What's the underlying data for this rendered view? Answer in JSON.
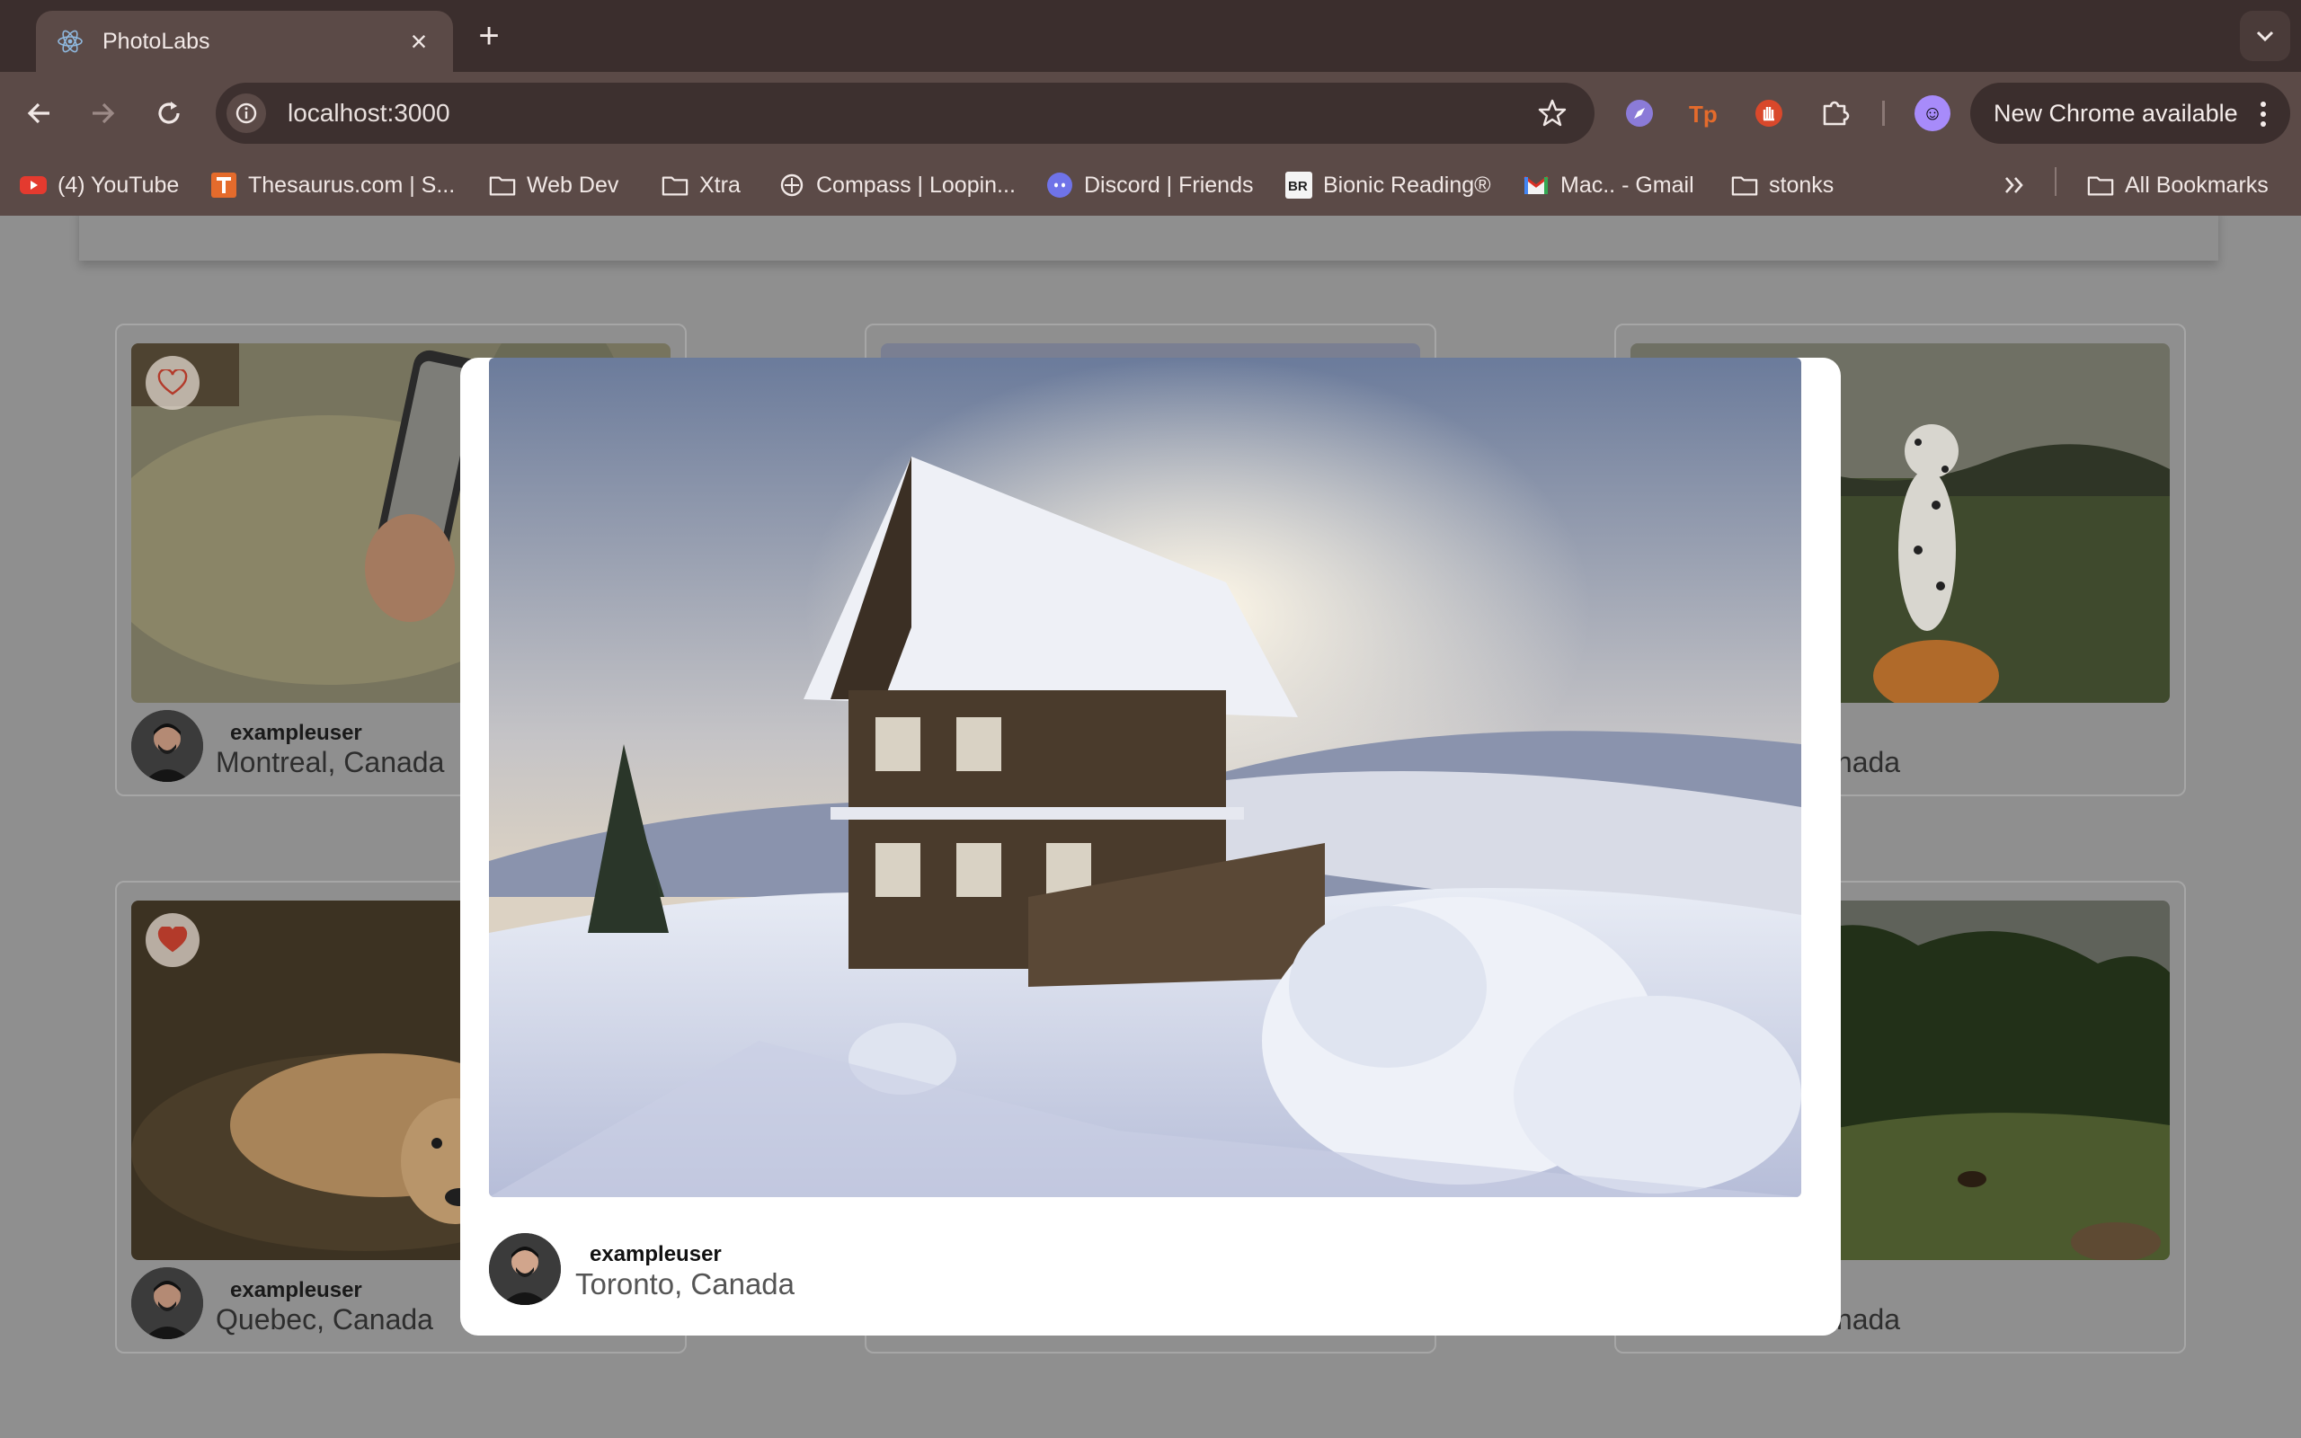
{
  "browser": {
    "tab_title": "PhotoLabs",
    "address": "localhost:3000",
    "update_label": "New Chrome available",
    "bookmarks": [
      {
        "label": "(4) YouTube",
        "icon": "youtube-icon"
      },
      {
        "label": "Thesaurus.com | S...",
        "icon": "thesaurus-icon"
      },
      {
        "label": "Web Dev",
        "icon": "folder-icon"
      },
      {
        "label": "Xtra",
        "icon": "folder-icon"
      },
      {
        "label": "Compass | Loopin...",
        "icon": "compass-icon"
      },
      {
        "label": "Discord | Friends",
        "icon": "discord-icon"
      },
      {
        "label": "Bionic Reading®",
        "icon": "bionic-reading-icon"
      },
      {
        "label": "Mac.. - Gmail",
        "icon": "gmail-icon"
      },
      {
        "label": "stonks",
        "icon": "folder-icon"
      }
    ],
    "all_bookmarks_label": "All Bookmarks",
    "colors": {
      "tabstrip": "#3b2e2d",
      "toolbar": "#5b4a47",
      "omnibox": "#3d302f"
    }
  },
  "photo_grid": {
    "cards": [
      {
        "username": "exampleuser",
        "location": "Montreal, Canada",
        "favourited": false,
        "image": "hand holding phone"
      },
      {
        "username": "",
        "location": "",
        "favourited": false,
        "image": "hidden behind modal"
      },
      {
        "username": "exampleuser",
        "location": "Canada",
        "favourited": false,
        "image": "dalmatian on pumpkin"
      },
      {
        "username": "exampleuser",
        "location": "Quebec, Canada",
        "favourited": true,
        "image": "dog lying down"
      },
      {
        "username": "",
        "location": "",
        "favourited": false,
        "image": "hidden behind modal"
      },
      {
        "username": "exampleuser",
        "location": "Canada",
        "favourited": false,
        "image": "horses on hill"
      }
    ],
    "partial_user_suffix": "ser"
  },
  "modal": {
    "image": "snowy wooden chalet on hillside at sunrise",
    "username": "exampleuser",
    "location": "Toronto, Canada"
  },
  "accent_colors": {
    "favourite_active": "#c0392b"
  }
}
